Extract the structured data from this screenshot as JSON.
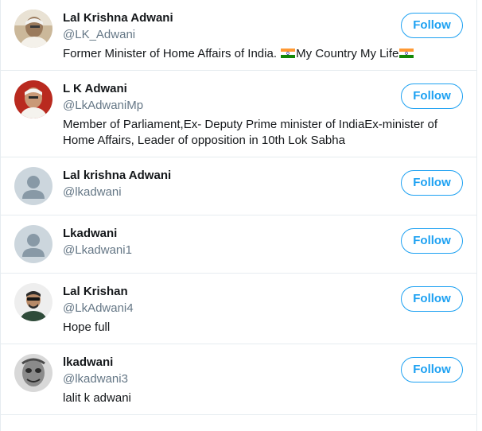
{
  "users": [
    {
      "name": "Lal Krishna Adwani",
      "handle": "@LK_Adwani",
      "bio_before": "Former Minister of Home Affairs of India. ",
      "bio_middle": "My Country My Life",
      "bio_flag_icon": "india-flag-icon",
      "follow_label": "Follow",
      "avatar": "photo"
    },
    {
      "name": "L K Adwani",
      "handle": "@LkAdwaniMp",
      "bio": "Member of Parliament,Ex- Deputy Prime minister of IndiaEx-minister of Home Affairs, Leader of opposition in 10th Lok Sabha",
      "follow_label": "Follow",
      "avatar": "photo"
    },
    {
      "name": "Lal krishna Adwani",
      "handle": "@lkadwani",
      "follow_label": "Follow",
      "avatar": "default-avatar-icon"
    },
    {
      "name": "Lkadwani",
      "handle": "@Lkadwani1",
      "follow_label": "Follow",
      "avatar": "default-avatar-icon"
    },
    {
      "name": "Lal Krishan",
      "handle": "@LkAdwani4",
      "bio": "Hope full",
      "follow_label": "Follow",
      "avatar": "photo"
    },
    {
      "name": "lkadwani",
      "handle": "@lkadwani3",
      "bio": "lalit k adwani",
      "follow_label": "Follow",
      "avatar": "photo"
    }
  ],
  "colors": {
    "accent": "#1da1f2",
    "secondary_text": "#657786",
    "primary_text": "#14171a",
    "divider": "#e6ecf0",
    "default_avatar_bg": "#ccd6dd",
    "default_avatar_fg": "#8899a6"
  }
}
